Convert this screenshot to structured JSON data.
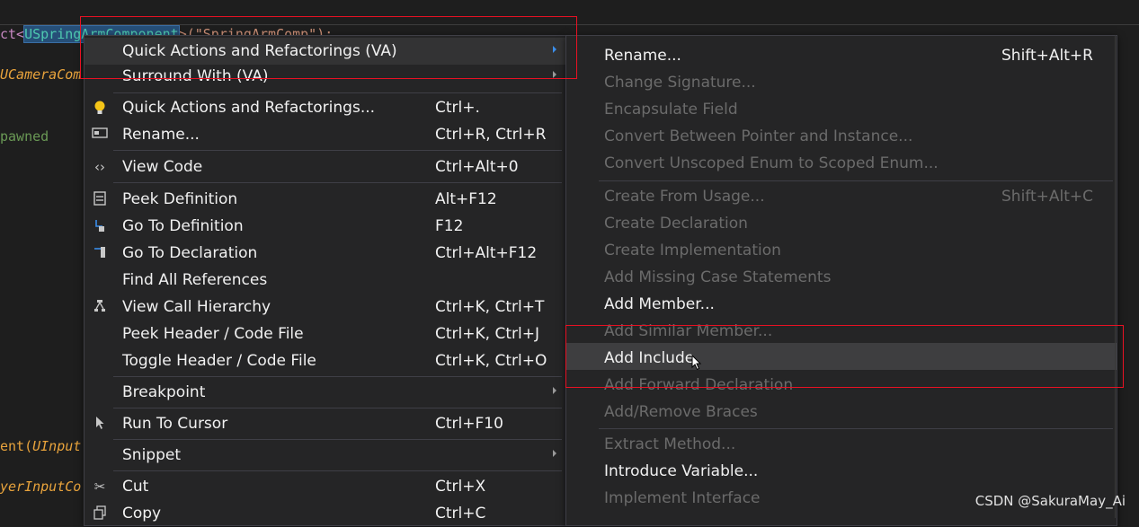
{
  "editor": {
    "line1": {
      "kw": "ct<",
      "type": "USpringArmComponent",
      "rest": ">(\"SpringArmComp\");"
    },
    "line2": "UCameraCom",
    "line3": "pawned",
    "line4": {
      "fn": "ent(",
      "param": "UInput"
    },
    "line5": "yerInputCo"
  },
  "main_menu": {
    "items": [
      {
        "label": "Quick Actions and Refactorings (VA)",
        "shortcut": "",
        "submenu": true,
        "icon": ""
      },
      {
        "label": "Surround With (VA)",
        "shortcut": "",
        "submenu": true,
        "icon": ""
      },
      {
        "label": "Quick Actions and Refactorings...",
        "shortcut": "Ctrl+.",
        "submenu": false,
        "icon": "lightbulb-icon"
      },
      {
        "label": "Rename...",
        "shortcut": "Ctrl+R, Ctrl+R",
        "submenu": false,
        "icon": "rename-icon"
      },
      {
        "label": "View Code",
        "shortcut": "Ctrl+Alt+0",
        "submenu": false,
        "icon": "code-icon"
      },
      {
        "label": "Peek Definition",
        "shortcut": "Alt+F12",
        "submenu": false,
        "icon": "peek-icon"
      },
      {
        "label": "Go To Definition",
        "shortcut": "F12",
        "submenu": false,
        "icon": "goto-definition-icon"
      },
      {
        "label": "Go To Declaration",
        "shortcut": "Ctrl+Alt+F12",
        "submenu": false,
        "icon": "goto-declaration-icon"
      },
      {
        "label": "Find All References",
        "shortcut": "",
        "submenu": false,
        "icon": ""
      },
      {
        "label": "View Call Hierarchy",
        "shortcut": "Ctrl+K, Ctrl+T",
        "submenu": false,
        "icon": "call-hierarchy-icon"
      },
      {
        "label": "Peek Header / Code File",
        "shortcut": "Ctrl+K, Ctrl+J",
        "submenu": false,
        "icon": ""
      },
      {
        "label": "Toggle Header / Code File",
        "shortcut": "Ctrl+K, Ctrl+O",
        "submenu": false,
        "icon": ""
      },
      {
        "label": "Breakpoint",
        "shortcut": "",
        "submenu": true,
        "icon": ""
      },
      {
        "label": "Run To Cursor",
        "shortcut": "Ctrl+F10",
        "submenu": false,
        "icon": "run-cursor-icon"
      },
      {
        "label": "Snippet",
        "shortcut": "",
        "submenu": true,
        "icon": ""
      },
      {
        "label": "Cut",
        "shortcut": "Ctrl+X",
        "submenu": false,
        "icon": "scissors-icon"
      },
      {
        "label": "Copy",
        "shortcut": "Ctrl+C",
        "submenu": false,
        "icon": "copy-icon"
      }
    ]
  },
  "sub_menu": {
    "items": [
      {
        "label": "Rename...",
        "shortcut": "Shift+Alt+R",
        "enabled": true
      },
      {
        "label": "Change Signature...",
        "shortcut": "",
        "enabled": false
      },
      {
        "label": "Encapsulate Field",
        "shortcut": "",
        "enabled": false
      },
      {
        "label": "Convert Between Pointer and Instance...",
        "shortcut": "",
        "enabled": false
      },
      {
        "label": "Convert Unscoped Enum to Scoped Enum...",
        "shortcut": "",
        "enabled": false
      },
      {
        "label": "Create From Usage...",
        "shortcut": "Shift+Alt+C",
        "enabled": false
      },
      {
        "label": "Create Declaration",
        "shortcut": "",
        "enabled": false
      },
      {
        "label": "Create Implementation",
        "shortcut": "",
        "enabled": false
      },
      {
        "label": "Add Missing Case Statements",
        "shortcut": "",
        "enabled": false
      },
      {
        "label": "Add Member...",
        "shortcut": "",
        "enabled": true
      },
      {
        "label": "Add Similar Member...",
        "shortcut": "",
        "enabled": false
      },
      {
        "label": "Add Include",
        "shortcut": "",
        "enabled": true
      },
      {
        "label": "Add Forward Declaration",
        "shortcut": "",
        "enabled": false
      },
      {
        "label": "Add/Remove Braces",
        "shortcut": "",
        "enabled": false
      },
      {
        "label": "Extract Method...",
        "shortcut": "",
        "enabled": false
      },
      {
        "label": "Introduce Variable...",
        "shortcut": "",
        "enabled": true
      },
      {
        "label": "Implement Interface",
        "shortcut": "",
        "enabled": false
      }
    ]
  },
  "watermark": "CSDN @SakuraMay_Ai",
  "colors": {
    "highlight_box": "#e81123",
    "menu_bg": "#252526",
    "accent_arrow": "#3b8eea"
  }
}
